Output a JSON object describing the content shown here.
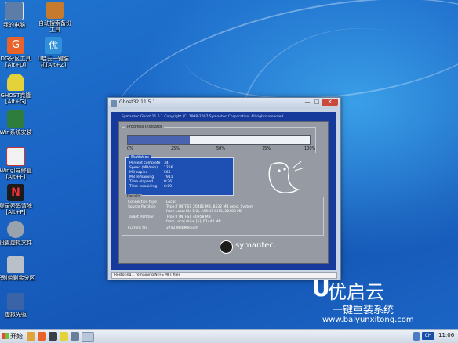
{
  "desktop_icons": [
    {
      "label": "我的电脑",
      "icon": "computer-icon"
    },
    {
      "label": "自动搜索备份工具",
      "icon": "ghost-search-icon"
    },
    {
      "label": "DG分区工具[Alt+D]",
      "icon": "diskgenius-icon"
    },
    {
      "label": "U启动一键装机[Alt+Z]",
      "icon": "onekey-install-icon"
    },
    {
      "label": "GHOST克隆[Alt+G]",
      "icon": "ghost-icon"
    },
    {
      "label": "Win系统安装",
      "icon": "win-install-icon"
    },
    {
      "label": "Win引导修复[Alt+F]",
      "icon": "boot-repair-icon"
    },
    {
      "label": "登录密码清除[Alt+P]",
      "icon": "password-clear-icon"
    },
    {
      "label": "设置虚拟文件",
      "icon": "virtual-file-icon"
    },
    {
      "label": "识别带剩余分区",
      "icon": "partition-icon"
    },
    {
      "label": "虚拟光驱",
      "icon": "virtual-drive-icon"
    }
  ],
  "ghost_window": {
    "title": "Ghost32 11.5.1",
    "min_label": "—",
    "max_label": "□",
    "close_label": "✕",
    "header": "Symantec Ghost 11.5.1   Copyright (C) 1998-2007 Symantec Corporation. All rights reserved.",
    "progress": {
      "title": "Progress Indicator",
      "percent": 0.34,
      "ticks": [
        "0%",
        "25%",
        "50%",
        "75%",
        "100%"
      ]
    },
    "statistics": {
      "title": "Statistics",
      "rows": [
        {
          "label": "Percent complete",
          "value": "34"
        },
        {
          "label": "Speed (MB/min)",
          "value": "1256"
        },
        {
          "label": "MB copied",
          "value": "565"
        },
        {
          "label": "MB remaining",
          "value": "7911"
        },
        {
          "label": "Time elapsed",
          "value": "0:26"
        },
        {
          "label": "Time remaining",
          "value": "6:09"
        }
      ]
    },
    "details": {
      "title": "Details",
      "rows": [
        {
          "label": "Connection type",
          "value": "Local"
        },
        {
          "label": "Source Partition",
          "value": "Type:7 [NTFS], 20481 MB, 8532 MB used, System"
        },
        {
          "label": "",
          "value": "from Local file 1:2\\...\\WIN7.GHO, 20480 MB"
        },
        {
          "label": "Target Partition",
          "value": "Type:7 [NTFS], 40958 MB"
        },
        {
          "label": "",
          "value": "from Local drive [1], 61440 MB"
        },
        {
          "label": "Current file",
          "value": "2792 WebMedium"
        }
      ]
    },
    "brand": "symantec.",
    "status_text": "Restoring... remaining NTFS MFT files"
  },
  "watermark": {
    "logo_letter": "U",
    "brand": "优启云",
    "tagline": "一键重装系统",
    "url": "www.baiyunxitong.com"
  },
  "taskbar": {
    "start_label": "开始",
    "tray_lang": "CH",
    "clock": "11:06"
  },
  "colors": {
    "desktop": "#1a63c4",
    "ghost_bg": "#163a9c",
    "progress_fill": "#4a63b0",
    "stats_bg": "#1e4fb3"
  }
}
